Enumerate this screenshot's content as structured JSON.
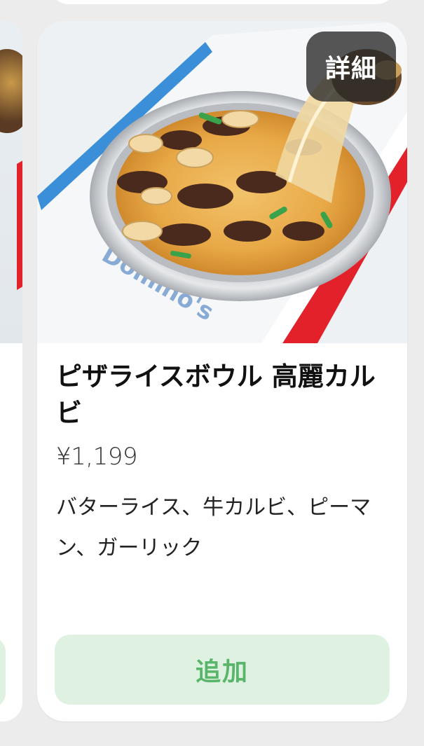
{
  "card": {
    "detail_label": "詳細",
    "name": "ピザライスボウル 高麗カルビ",
    "price": "¥1,199",
    "description": "バターライス、牛カルビ、ピーマン、ガーリック",
    "add_label": "追加",
    "image_icon": "pizza-rice-bowl-photo"
  },
  "colors": {
    "add_button_bg": "#dff2e2",
    "add_button_text": "#58b56a",
    "detail_button_bg": "#2b2b2b",
    "page_bg": "#ececec",
    "card_bg": "#ffffff"
  }
}
